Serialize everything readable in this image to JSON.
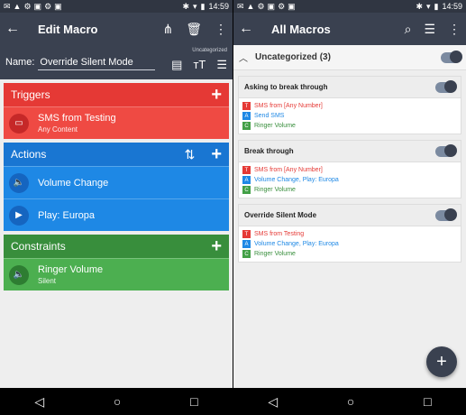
{
  "status": {
    "time": "14:59"
  },
  "left": {
    "title": "Edit Macro",
    "back_icon": "arrow-back-icon",
    "name_label": "Name:",
    "name_value": "Override Silent Mode",
    "category": "Uncategorized",
    "triggers": {
      "header": "Triggers",
      "items": [
        {
          "label": "SMS from Testing",
          "sub": "Any Content"
        }
      ]
    },
    "actions": {
      "header": "Actions",
      "items": [
        {
          "label": "Volume Change"
        },
        {
          "label": "Play: Europa"
        }
      ]
    },
    "constraints": {
      "header": "Constraints",
      "items": [
        {
          "label": "Ringer Volume",
          "sub": "Silent"
        }
      ]
    }
  },
  "right": {
    "title": "All Macros",
    "group": {
      "name": "Uncategorized",
      "count": "(3)"
    },
    "macros": [
      {
        "name": "Asking to break through",
        "trigger": "SMS from [Any Number]",
        "action": "Send SMS",
        "constraint": "Ringer Volume"
      },
      {
        "name": "Break through",
        "trigger": "SMS from [Any Number]",
        "action": "Volume Change, Play: Europa",
        "constraint": "Ringer Volume"
      },
      {
        "name": "Override Silent Mode",
        "trigger": "SMS from Testing",
        "action": "Volume Change, Play: Europa",
        "constraint": "Ringer Volume"
      }
    ],
    "tag_letters": {
      "t": "T",
      "a": "A",
      "c": "C"
    }
  },
  "colors": {
    "appbar": "#3a4150",
    "trigger": "#e53935",
    "action": "#1e88e5",
    "constraint": "#4caf50"
  }
}
